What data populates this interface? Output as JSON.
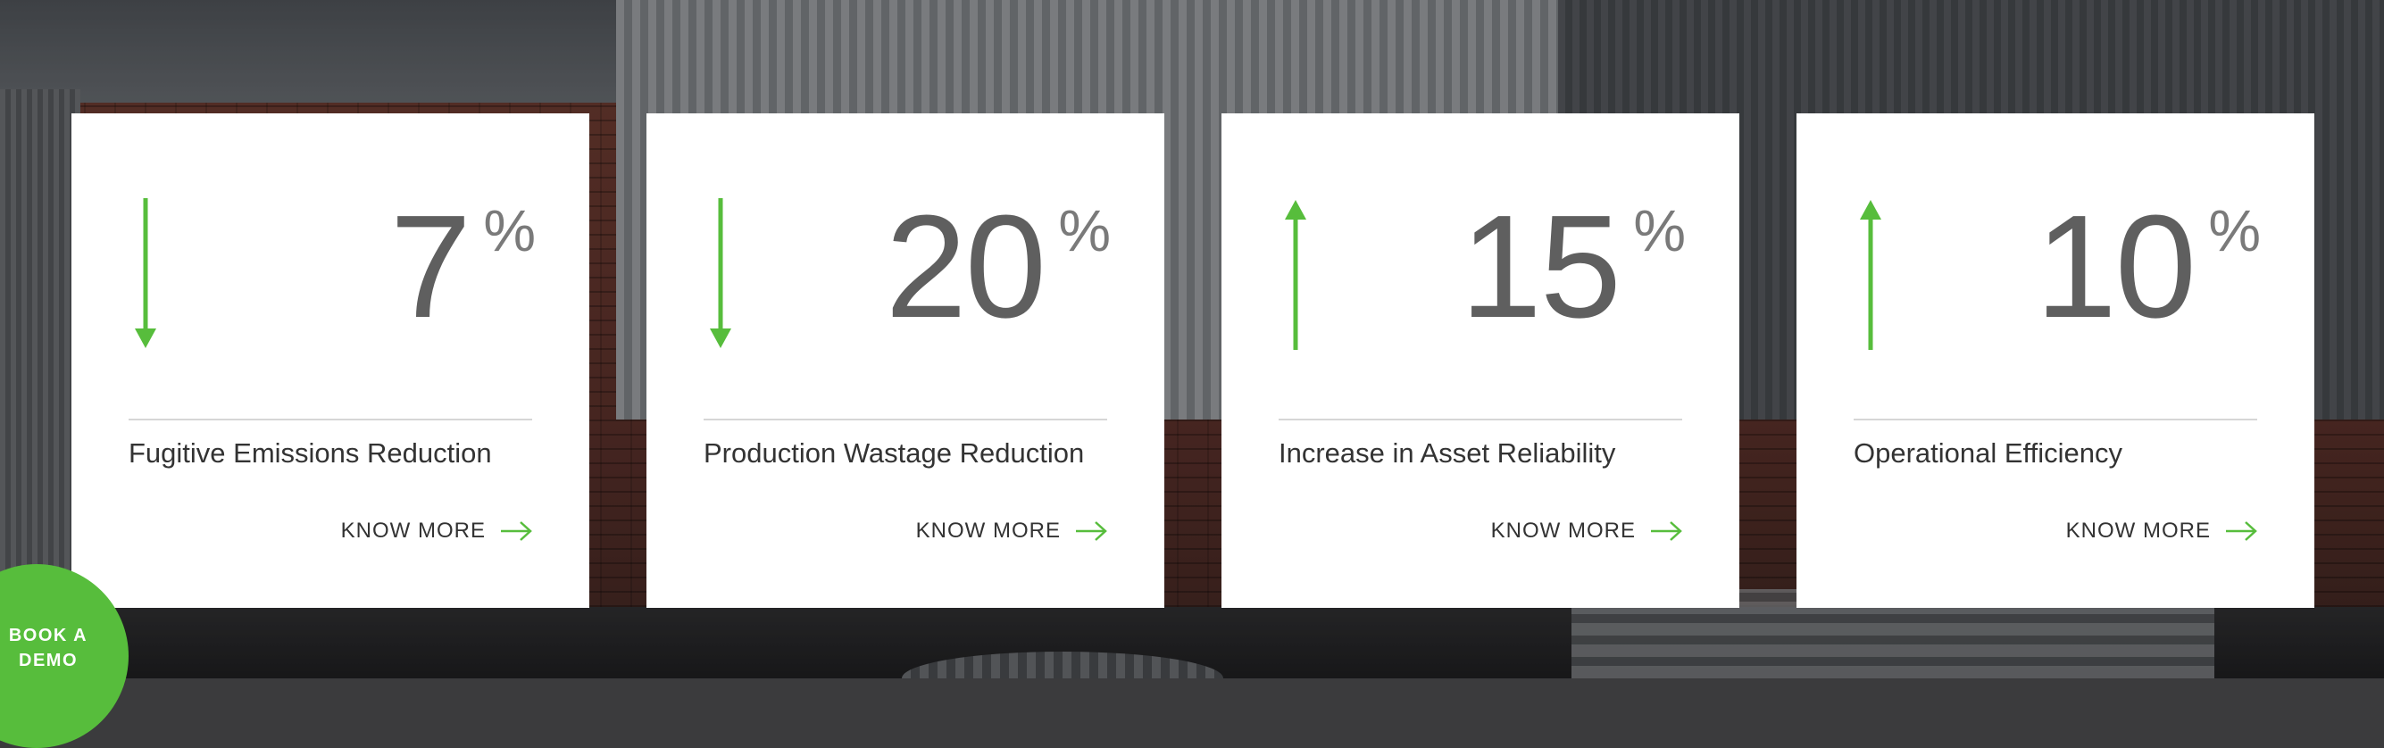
{
  "stats": [
    {
      "value": "7",
      "unit": "%",
      "direction": "down",
      "label": "Fugitive Emissions Reduction",
      "cta": "KNOW MORE",
      "arrow_icon": "arrow-down-icon"
    },
    {
      "value": "20",
      "unit": "%",
      "direction": "down",
      "label": "Production Wastage Reduction",
      "cta": "KNOW MORE",
      "arrow_icon": "arrow-down-icon"
    },
    {
      "value": "15",
      "unit": "%",
      "direction": "up",
      "label": "Increase in Asset Reliability",
      "cta": "KNOW MORE",
      "arrow_icon": "arrow-up-icon"
    },
    {
      "value": "10",
      "unit": "%",
      "direction": "up",
      "label": "Operational Efficiency",
      "cta": "KNOW MORE",
      "arrow_icon": "arrow-up-icon"
    }
  ],
  "demo_button": {
    "label": "BOOK A DEMO"
  },
  "colors": {
    "accent": "#57bd3c",
    "value_text": "#5f5f5f",
    "card_bg": "#ffffff",
    "divider": "#d6d6d6"
  }
}
